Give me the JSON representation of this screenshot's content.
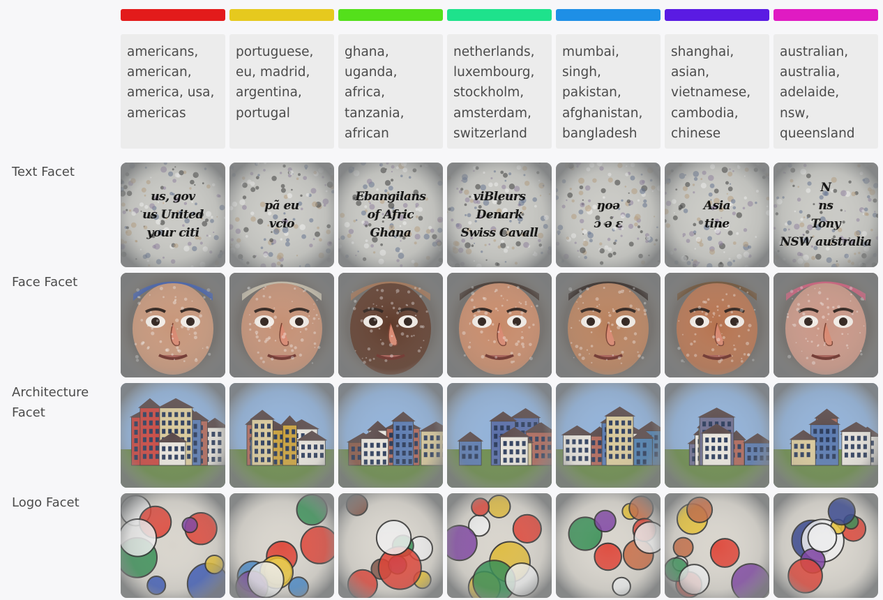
{
  "columns": [
    {
      "color": "#e31b1b",
      "keywords": "americans, american, america, usa, americas",
      "text_facet": [
        "us, gov",
        "us United",
        "your citi"
      ],
      "face_tone": "#c79578",
      "face_accent": "#3a5bb0",
      "arch_tone": "#c9463f",
      "logo_tone": "#2f4fb5"
    },
    {
      "color": "#e6c91e",
      "keywords": "portuguese, eu, madrid, argentina, portugal",
      "text_facet": [
        "pã eu",
        "vcio"
      ],
      "face_tone": "#c48f73",
      "face_accent": "#cfc7b0",
      "arch_tone": "#c9a13f",
      "logo_tone": "#3c83c8"
    },
    {
      "color": "#54e01b",
      "keywords": "ghana, uganda, africa, tanzania, african",
      "text_facet": [
        "Ebangilans",
        "of Afric",
        "Ghana"
      ],
      "face_tone": "#5e3a2a",
      "face_accent": "#a8734f",
      "arch_tone": "#8a5a4a",
      "logo_tone": "#7a4a3c"
    },
    {
      "color": "#1ee28c",
      "keywords": "netherlands, luxembourg, stockholm, amsterdam, switzerland",
      "text_facet": [
        "viBleurs",
        "Denark",
        "Swiss Cavall"
      ],
      "face_tone": "#c78968",
      "face_accent": "#3a2a22",
      "arch_tone": "#5a6fa8",
      "logo_tone": "#e0b82f"
    },
    {
      "color": "#1e8fe6",
      "keywords": "mumbai, singh, pakistan, afghanistan, bangladesh",
      "text_facet": [
        "ŋoə",
        "ɔ ə ɛ"
      ],
      "face_tone": "#b8805c",
      "face_accent": "#2a1f1b",
      "arch_tone": "#4d7fb0",
      "logo_tone": "#c8643a"
    },
    {
      "color": "#5a1be3",
      "keywords": "shanghai, asian, vietnamese, cambodia, chinese",
      "text_facet": [
        "Asia",
        "tine"
      ],
      "face_tone": "#b5724e",
      "face_accent": "#6b4a2a",
      "arch_tone": "#6f6f90",
      "logo_tone": "#c4643a"
    },
    {
      "color": "#e01bc2",
      "keywords": "australian, australia, adelaide, nsw, queensland",
      "text_facet": [
        "N",
        "ns",
        "Tony",
        "NSW australia"
      ],
      "face_tone": "#c99584",
      "face_accent": "#d85a7a",
      "arch_tone": "#a86a5a",
      "logo_tone": "#2a3a8a"
    }
  ],
  "rows": [
    {
      "label": "Text Facet",
      "kind": "text"
    },
    {
      "label": "Face Facet",
      "kind": "face"
    },
    {
      "label": "Architecture Facet",
      "kind": "arch"
    },
    {
      "label": "Logo Facet",
      "kind": "logo"
    }
  ]
}
